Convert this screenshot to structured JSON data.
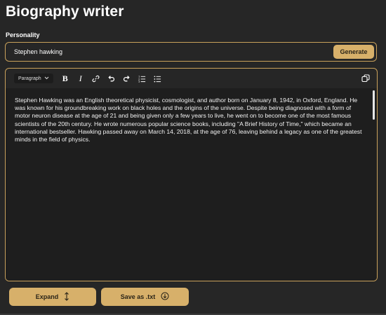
{
  "page": {
    "title": "Biography writer"
  },
  "personality": {
    "label": "Personality",
    "value": "Stephen hawking",
    "generate_label": "Generate"
  },
  "editor": {
    "toolbar": {
      "block_format": "Paragraph",
      "icons": [
        "chevron-down-icon",
        "bold-icon",
        "italic-icon",
        "link-icon",
        "undo-icon",
        "redo-icon",
        "ordered-list-icon",
        "bullet-list-icon",
        "copy-icon"
      ]
    },
    "content": "Stephen Hawking was an English theoretical physicist, cosmologist, and author born on January 8, 1942, in Oxford, England. He was known for his groundbreaking work on black holes and the origins of the universe. Despite being diagnosed with a form of motor neuron disease  at the age of 21 and being given only a few years to live, he went on to become one of the most famous scientists of the 20th century. He wrote numerous popular science books, including \"A Brief History of Time,\" which became an international bestseller. Hawking passed away on March 14, 2018, at the age of 76, leaving behind a legacy as one of the greatest minds in the field of physics."
  },
  "actions": {
    "expand_label": "Expand",
    "save_label": "Save as .txt"
  },
  "colors": {
    "accent": "#d7b06a",
    "border": "#c9a15b",
    "background": "#262626",
    "editor_bg": "#1e1e1e"
  }
}
